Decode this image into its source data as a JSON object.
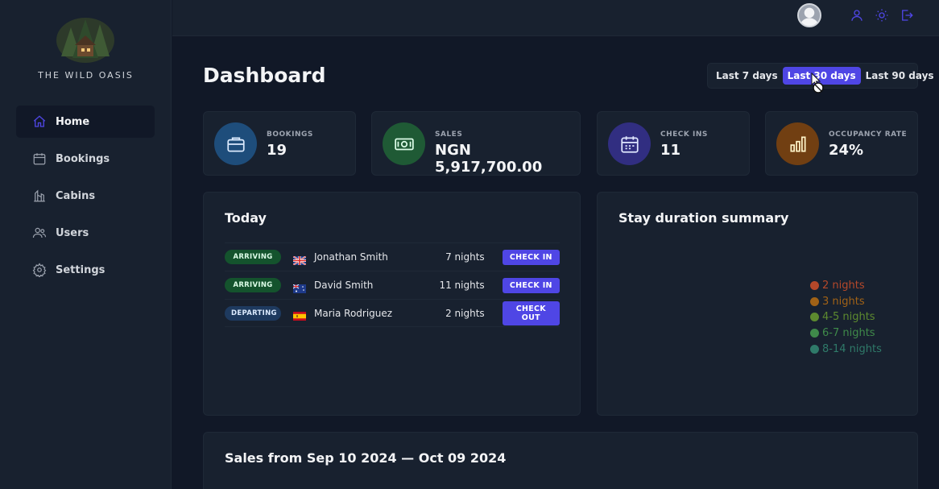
{
  "brand": {
    "name": "THE WILD OASIS"
  },
  "sidebar": {
    "items": [
      {
        "label": "Home",
        "icon": "home-icon",
        "active": true
      },
      {
        "label": "Bookings",
        "icon": "calendar-icon",
        "active": false
      },
      {
        "label": "Cabins",
        "icon": "cabin-icon",
        "active": false
      },
      {
        "label": "Users",
        "icon": "users-icon",
        "active": false
      },
      {
        "label": "Settings",
        "icon": "gear-icon",
        "active": false
      }
    ]
  },
  "header": {
    "icons": [
      "user-icon",
      "sun-icon",
      "logout-icon"
    ],
    "accent": "#4f46e5"
  },
  "dashboard": {
    "title": "Dashboard",
    "filters": [
      {
        "label": "Last 7 days",
        "active": false
      },
      {
        "label": "Last 30 days",
        "active": true
      },
      {
        "label": "Last 90 days",
        "active": false
      }
    ]
  },
  "stats": [
    {
      "label": "BOOKINGS",
      "value": "19",
      "icon": "briefcase-icon",
      "color": "#1e4d7b"
    },
    {
      "label": "SALES",
      "value": "NGN 5,917,700.00",
      "icon": "banknotes-icon",
      "color": "#1f5a35"
    },
    {
      "label": "CHECK INS",
      "value": "11",
      "icon": "calendar-days-icon",
      "color": "#312e81"
    },
    {
      "label": "OCCUPANCY RATE",
      "value": "24%",
      "icon": "chart-bar-icon",
      "color": "#713f12"
    }
  ],
  "today": {
    "title": "Today",
    "activities": [
      {
        "status": "ARRIVING",
        "flag": "flag-uk-icon",
        "guest": "Jonathan Smith",
        "nights": "7 nights",
        "action": "CHECK IN"
      },
      {
        "status": "ARRIVING",
        "flag": "flag-au-icon",
        "guest": "David Smith",
        "nights": "11 nights",
        "action": "CHECK IN"
      },
      {
        "status": "DEPARTING",
        "flag": "flag-es-icon",
        "guest": "Maria Rodriguez",
        "nights": "2 nights",
        "action": "CHECK OUT"
      }
    ]
  },
  "stay_summary": {
    "title": "Stay duration summary",
    "legend": [
      {
        "label": "2 nights",
        "color": "#b5482a"
      },
      {
        "label": "3 nights",
        "color": "#a16216"
      },
      {
        "label": "4-5 nights",
        "color": "#5d8a2f"
      },
      {
        "label": "6-7 nights",
        "color": "#3f8a4a"
      },
      {
        "label": "8-14 nights",
        "color": "#2f7a69"
      }
    ]
  },
  "sales": {
    "title": "Sales from Sep 10 2024 — Oct 09 2024"
  }
}
